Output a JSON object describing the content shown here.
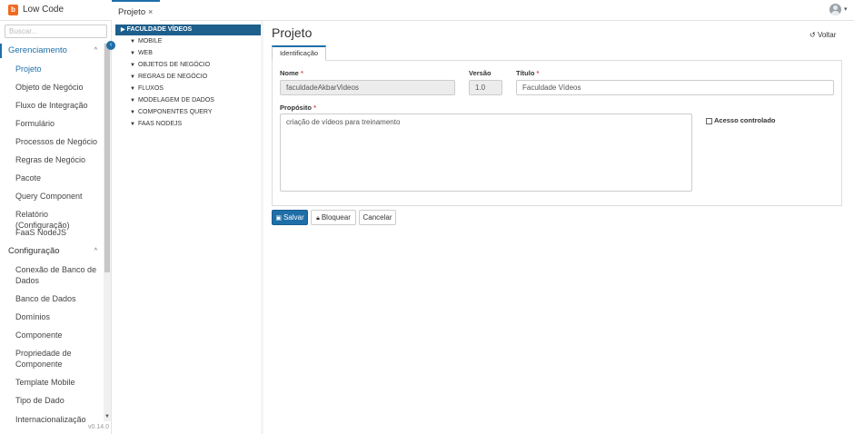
{
  "app": {
    "title": "Low Code",
    "logo_letter": "b",
    "version": "v0.14.0"
  },
  "tabs": [
    {
      "label": "Projeto",
      "close": "×"
    }
  ],
  "sidebar": {
    "search_placeholder": "Buscar...",
    "collapse_icon": "‹",
    "sections": [
      {
        "label": "Gerenciamento",
        "chevron": "^"
      },
      {
        "label": "Configuração",
        "chevron": "^"
      }
    ],
    "items": [
      "Projeto",
      "Objeto de Negócio",
      "Fluxo de Integração",
      "Formulário",
      "Processos de Negócio",
      "Regras de Negócio",
      "Pacote",
      "Query Component",
      "Relatório (Configuração)",
      "FaaS NodeJS",
      "Conexão de Banco de Dados",
      "Banco de Dados",
      "Domínios",
      "Componente",
      "Propriedade de Componente",
      "Template Mobile",
      "Tipo de Dado",
      "Internacionalização"
    ],
    "scroll_up": "▲",
    "scroll_down": "▼"
  },
  "tree": {
    "root": "FACULDADE VÍDEOS",
    "nodes": [
      "MOBILE",
      "WEB",
      "OBJETOS DE NEGÓCIO",
      "REGRAS DE NEGÓCIO",
      "FLUXOS",
      "MODELAGEM DE DADOS",
      "COMPONENTES QUERY",
      "FAAS NODEJS"
    ]
  },
  "main": {
    "title": "Projeto",
    "back_label": "Voltar",
    "tab_label": "Identificação",
    "fields": {
      "nome": {
        "label": "Nome",
        "value": "faculdadeAkbarVideos"
      },
      "versao": {
        "label": "Versão",
        "value": "1.0"
      },
      "titulo": {
        "label": "Título",
        "value": "Faculdade Vídeos"
      },
      "proposito": {
        "label": "Propósito",
        "value": "criação de vídeos para treinamento"
      },
      "acesso": {
        "label": "Acesso controlado",
        "checked": false
      }
    },
    "required_mark": "*",
    "buttons": {
      "save": "Salvar",
      "lock": "Bloquear",
      "cancel": "Cancelar"
    }
  },
  "colors": {
    "accent": "#1e6fa8",
    "tree_root": "#1e5f8c",
    "logo": "#f26a21",
    "required": "#d9534f"
  }
}
